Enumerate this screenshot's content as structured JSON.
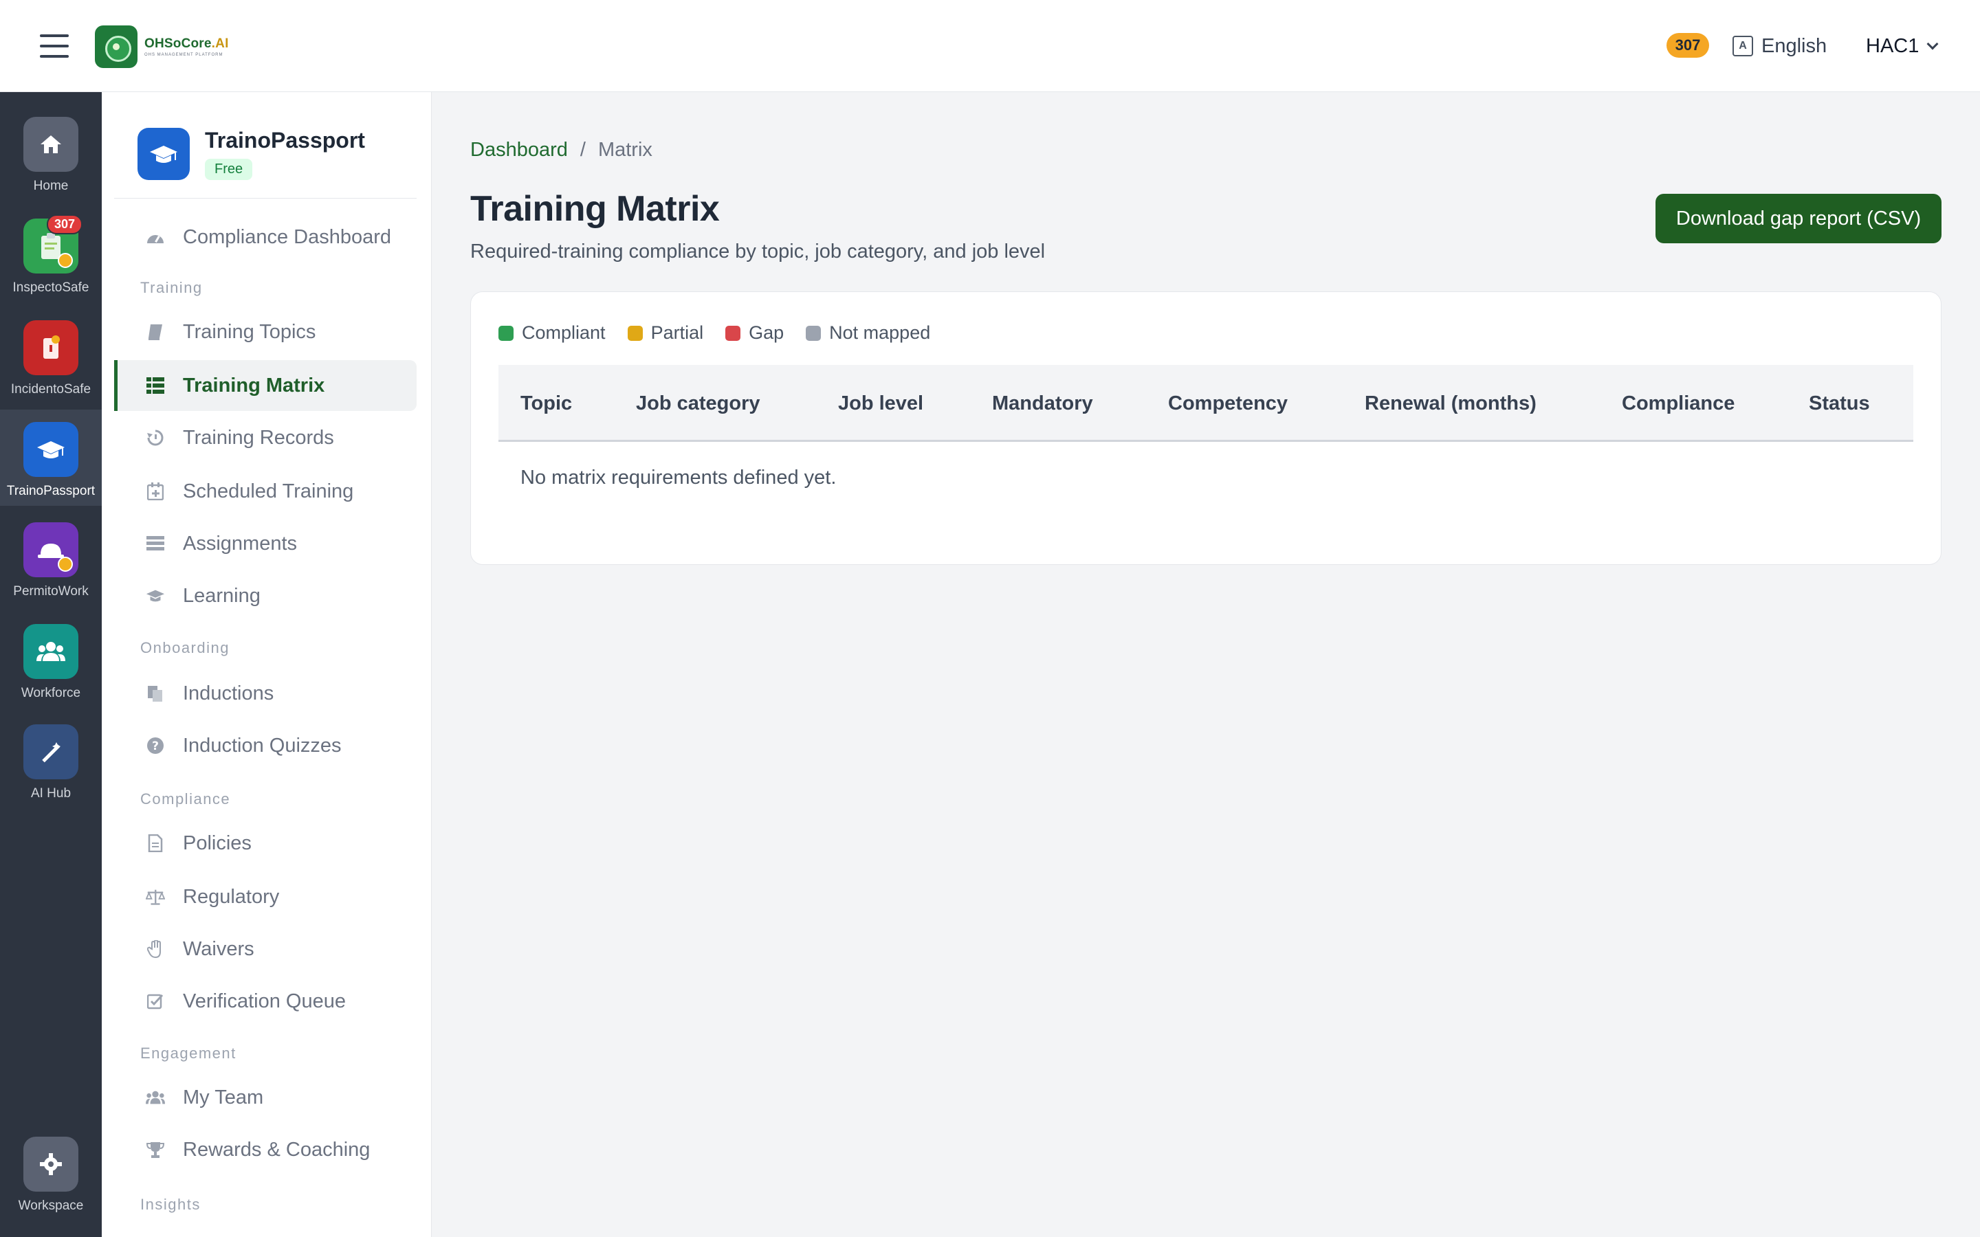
{
  "topbar": {
    "brand_name": "OHSoCore",
    "brand_suffix": ".AI",
    "brand_tagline": "OHS MANAGEMENT PLATFORM",
    "notification_count": "307",
    "language": "English",
    "user": "HAC1"
  },
  "rail": [
    {
      "label": "Home",
      "icon": "home-icon",
      "color": "#5b6272"
    },
    {
      "label": "InspectoSafe",
      "icon": "clipboard-check-icon",
      "color": "#2fa352",
      "badge": "307"
    },
    {
      "label": "IncidentoSafe",
      "icon": "alert-document-icon",
      "color": "#c62828"
    },
    {
      "label": "TrainoPassport",
      "icon": "graduation-cap-icon",
      "color": "#1e66d0",
      "active": true
    },
    {
      "label": "PermitoWork",
      "icon": "hardhat-icon",
      "color": "#6f35b8"
    },
    {
      "label": "Workforce",
      "icon": "users-icon",
      "color": "#14958a"
    },
    {
      "label": "AI Hub",
      "icon": "magic-wand-icon",
      "color": "#34507f"
    },
    {
      "label": "Workspace",
      "icon": "gear-icon",
      "color": "#5b6272"
    }
  ],
  "sidebar": {
    "module_name": "TrainoPassport",
    "plan": "Free",
    "sections": {
      "training": "Training",
      "onboarding": "Onboarding",
      "compliance": "Compliance",
      "engagement": "Engagement",
      "insights": "Insights"
    },
    "items": {
      "compliance_dashboard": "Compliance Dashboard",
      "training_topics": "Training Topics",
      "training_matrix": "Training Matrix",
      "training_records": "Training Records",
      "scheduled_training": "Scheduled Training",
      "assignments": "Assignments",
      "learning": "Learning",
      "inductions": "Inductions",
      "induction_quizzes": "Induction Quizzes",
      "policies": "Policies",
      "regulatory": "Regulatory",
      "waivers": "Waivers",
      "verification_queue": "Verification Queue",
      "my_team": "My Team",
      "rewards_coaching": "Rewards & Coaching"
    }
  },
  "main": {
    "breadcrumb": {
      "root": "Dashboard",
      "separator": "/",
      "current": "Matrix"
    },
    "title": "Training Matrix",
    "subtitle": "Required-training compliance by topic, job category, and job level",
    "download_button": "Download gap report (CSV)",
    "legend": [
      {
        "label": "Compliant",
        "color": "#2e9e52"
      },
      {
        "label": "Partial",
        "color": "#e0a816"
      },
      {
        "label": "Gap",
        "color": "#d9464a"
      },
      {
        "label": "Not mapped",
        "color": "#9ca3af"
      }
    ],
    "columns": [
      "Topic",
      "Job category",
      "Job level",
      "Mandatory",
      "Competency",
      "Renewal (months)",
      "Compliance",
      "Status"
    ],
    "empty_message": "No matrix requirements defined yet."
  },
  "colors": {
    "brand_green": "#1f5e22",
    "accent_orange": "#f5a623",
    "rail_bg": "#2d3440"
  }
}
